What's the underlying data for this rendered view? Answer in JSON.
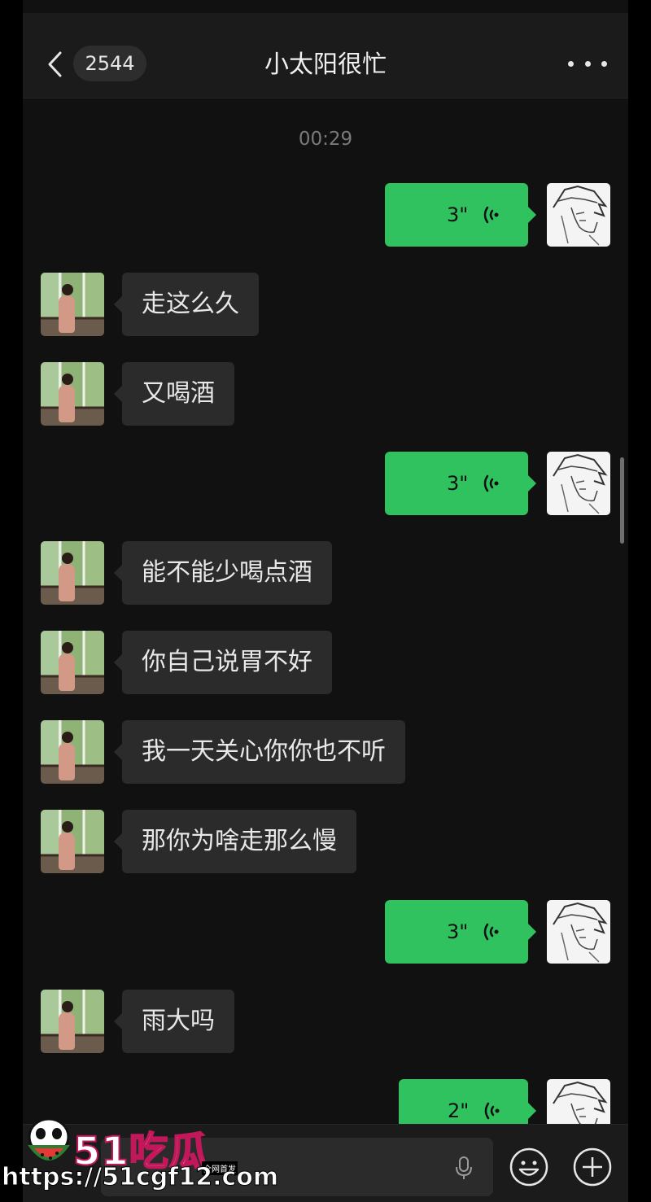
{
  "header": {
    "unread_count": "2544",
    "title": "小太阳很忙"
  },
  "timestamp": "00:29",
  "messages": [
    {
      "side": "out",
      "type": "voice",
      "duration": "3\""
    },
    {
      "side": "in",
      "type": "text",
      "text": "走这么久"
    },
    {
      "side": "in",
      "type": "text",
      "text": "又喝酒"
    },
    {
      "side": "out",
      "type": "voice",
      "duration": "3\""
    },
    {
      "side": "in",
      "type": "text",
      "text": "能不能少喝点酒"
    },
    {
      "side": "in",
      "type": "text",
      "text": "你自己说胃不好"
    },
    {
      "side": "in",
      "type": "text",
      "text": "我一天关心你你也不听"
    },
    {
      "side": "in",
      "type": "text",
      "text": "那你为啥走那么慢"
    },
    {
      "side": "out",
      "type": "voice",
      "duration": "3\""
    },
    {
      "side": "in",
      "type": "text",
      "text": "雨大吗"
    },
    {
      "side": "out",
      "type": "voice",
      "duration": "2\""
    }
  ],
  "watermark": {
    "brand_num": "51",
    "brand_text": "吃瓜",
    "tag": "全网首发",
    "url": "https://51cgf12.com"
  },
  "colors": {
    "background": "#111111",
    "incoming_bubble": "#2b2b2b",
    "outgoing_bubble": "#2fc25f"
  },
  "icons": [
    "back-chevron-icon",
    "more-dots-icon",
    "voice-wave-icon",
    "microphone-icon",
    "emoji-icon",
    "plus-icon"
  ]
}
